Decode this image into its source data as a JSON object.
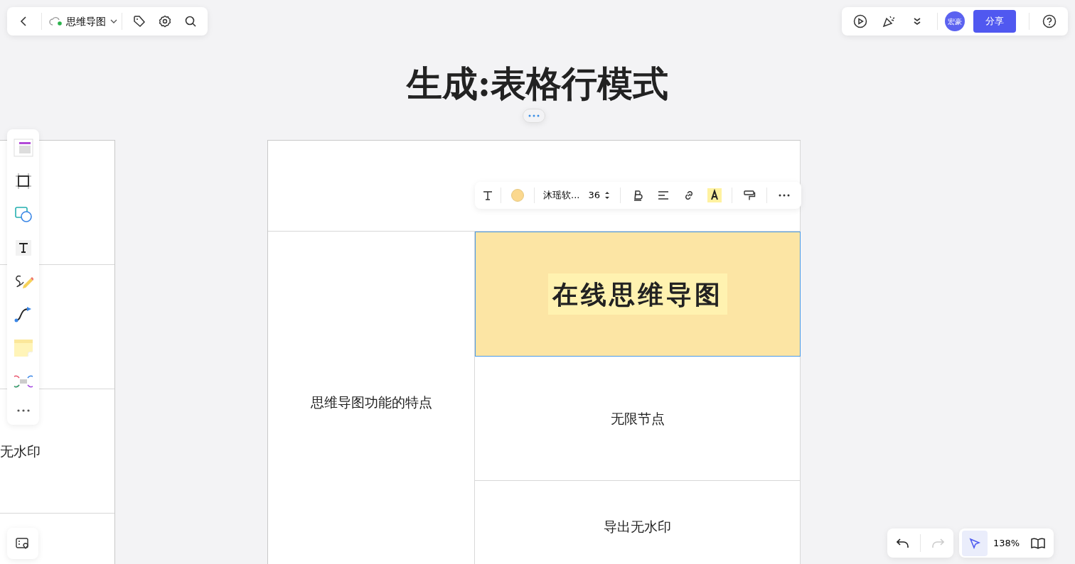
{
  "top_bar": {
    "document_title": "思维导图",
    "synced": true
  },
  "user_bar": {
    "avatar_text": "宏豪",
    "share_button": "分享"
  },
  "title": "生成:表格行模式",
  "text_toolbar": {
    "font_name": "沐瑶软...",
    "font_size": "36",
    "color": "#fbd88e"
  },
  "side_table": {
    "rows": [
      {
        "text": ""
      },
      {
        "text": ""
      },
      {
        "text": "无水印"
      },
      {
        "text": ""
      }
    ]
  },
  "table": {
    "row_header": "思维导图功能的特点",
    "cells": [
      {
        "text": "在线思维导图",
        "selected": true,
        "color": "#fce5a4"
      },
      {
        "text": "无限节点",
        "selected": false,
        "color": "#ffffff"
      },
      {
        "text": "导出无水印",
        "selected": false,
        "color": "#ffffff"
      }
    ]
  },
  "bottom_bar": {
    "zoom": "138%"
  }
}
